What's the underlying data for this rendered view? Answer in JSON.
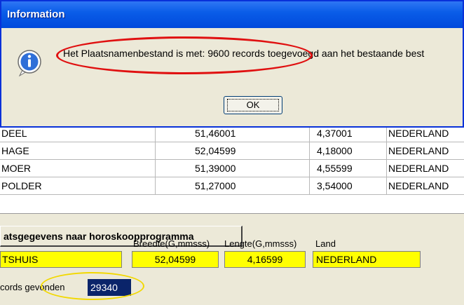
{
  "dialog": {
    "title": "Information",
    "message": "Het Plaatsnamenbestand is met: 9600 records toegevoegd aan het bestaande best",
    "ok_label": "OK",
    "icon": "info-icon"
  },
  "grid": {
    "rows": [
      {
        "name": "DEEL",
        "latitude": "51,46001",
        "longitude": "4,37001",
        "country": "NEDERLAND"
      },
      {
        "name": "HAGE",
        "latitude": "52,04599",
        "longitude": "4,18000",
        "country": "NEDERLAND"
      },
      {
        "name": "MOER",
        "latitude": "51,39000",
        "longitude": "4,55599",
        "country": "NEDERLAND"
      },
      {
        "name": "POLDER",
        "latitude": "51,27000",
        "longitude": "3,54000",
        "country": "NEDERLAND"
      }
    ]
  },
  "send_button_label": "atsgegevens naar horoskoopprogramma",
  "fields": {
    "breedte_label": "Breedte(G,mmsss)",
    "lengte_label": "Lengte(G,mmsss)",
    "land_label": "Land",
    "place_value": "TSHUIS",
    "breedte_value": "52,04599",
    "lengte_value": "4,16599",
    "land_value": "NEDERLAND"
  },
  "records": {
    "label": "cords gevonden",
    "value": "29340"
  },
  "colors": {
    "titlebar": "#0a5de8",
    "highlight_field": "#ffff00",
    "annotation_red": "#e01010",
    "annotation_yellow": "#f2d800",
    "selection": "#0a246a"
  }
}
